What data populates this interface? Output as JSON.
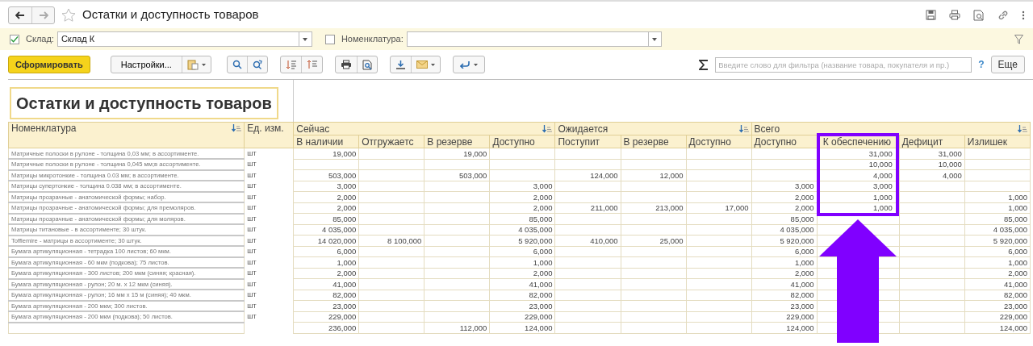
{
  "window": {
    "title": "Остатки и доступность товаров"
  },
  "filters": [
    {
      "label": "Склад:",
      "checked": true,
      "value": "Склад К"
    },
    {
      "label": "Номенклатура:",
      "checked": false
    }
  ],
  "toolbar": {
    "generate_button": "Сформировать",
    "settings_button": "Настройки...",
    "search": {
      "placeholder": "Введите слово для фильтра (название товара, покупателя и пр.)"
    },
    "help": "?",
    "more_button": "Еще"
  },
  "report": {
    "title": "Остатки и доступность товаров",
    "name_column": "Номенклатура",
    "unit_column": "Ед. изм.",
    "groups": [
      {
        "label": "Сейчас",
        "columns": [
          {
            "label": "В наличии",
            "highlighted": false
          },
          {
            "label": "Отгружаетс",
            "highlighted": false
          },
          {
            "label": "В резерве",
            "highlighted": false
          },
          {
            "label": "Доступно",
            "highlighted": false
          }
        ]
      },
      {
        "label": "Ожидается",
        "columns": [
          {
            "label": "Поступит",
            "highlighted": false
          },
          {
            "label": "В резерве",
            "highlighted": false
          },
          {
            "label": "Доступно",
            "highlighted": false
          }
        ]
      },
      {
        "label": "Всего",
        "columns": [
          {
            "label": "Доступно",
            "highlighted": false
          },
          {
            "label": "К обеспечению",
            "highlighted": true
          },
          {
            "label": "Дефицит",
            "highlighted": false
          },
          {
            "label": "Излишек",
            "highlighted": false
          }
        ]
      }
    ],
    "rows": [
      {
        "name": "Матричные полоски в рулоне - толщина 0,03 мм; в ассортименте.",
        "unit": "шт",
        "highlighted": true,
        "cells": [
          "19,000",
          null,
          "19,000",
          null,
          null,
          null,
          null,
          null,
          "31,000",
          "31,000",
          null
        ]
      },
      {
        "name": "Матричные полоски в рулоне - толщина 0,045 мм;в ассортименте.",
        "unit": "шт",
        "highlighted": true,
        "cells": [
          null,
          null,
          null,
          null,
          null,
          null,
          null,
          null,
          "10,000",
          "10,000",
          null
        ]
      },
      {
        "name": "Матрицы микротонкие - толщина 0.03 мм; в ассортименте.",
        "unit": "шт",
        "highlighted": true,
        "cells": [
          "503,000",
          null,
          "503,000",
          null,
          "124,000",
          "12,000",
          null,
          null,
          "4,000",
          "4,000",
          null
        ]
      },
      {
        "name": "Матрицы супертонкие - толщина 0.038 мм; в ассортименте.",
        "unit": "шт",
        "highlighted": true,
        "cells": [
          "3,000",
          null,
          null,
          "3,000",
          null,
          null,
          null,
          "3,000",
          "3,000",
          null,
          null
        ]
      },
      {
        "name": "Матрицы прозрачные - анатомической формы; набор.",
        "unit": "шт",
        "highlighted": true,
        "cells": [
          "2,000",
          null,
          null,
          "2,000",
          null,
          null,
          null,
          "2,000",
          "1,000",
          null,
          "1,000"
        ]
      },
      {
        "name": "Матрицы прозрачные - анатомической формы; для премоляров.",
        "unit": "шт",
        "highlighted": true,
        "cells": [
          "2,000",
          null,
          null,
          "2,000",
          "211,000",
          "213,000",
          "17,000",
          "2,000",
          "1,000",
          null,
          "1,000"
        ]
      },
      {
        "name": "Матрицы прозрачные -  анатомической формы; для моляров.",
        "unit": "шт",
        "highlighted": false,
        "cells": [
          "85,000",
          null,
          null,
          "85,000",
          null,
          null,
          null,
          "85,000",
          null,
          null,
          "85,000"
        ]
      },
      {
        "name": "Матрицы титановые - в ассортименте; 30 штук.",
        "unit": "шт",
        "highlighted": false,
        "cells": [
          "4 035,000",
          null,
          null,
          "4 035,000",
          null,
          null,
          null,
          "4 035,000",
          null,
          null,
          "4 035,000"
        ]
      },
      {
        "name": "Tofflemire - матрицы в ассортименте; 30 штук.",
        "unit": "шт",
        "highlighted": false,
        "cells": [
          "14 020,000",
          "8 100,000",
          null,
          "5 920,000",
          "410,000",
          "25,000",
          null,
          "5 920,000",
          null,
          null,
          "5 920,000"
        ]
      },
      {
        "name": "Бумага артикуляционная - тетрадка 100 листов; 60 мкм.",
        "unit": "шт",
        "highlighted": false,
        "cells": [
          "6,000",
          null,
          null,
          "6,000",
          null,
          null,
          null,
          "6,000",
          null,
          null,
          "6,000"
        ]
      },
      {
        "name": "Бумага артикуляционная - 60 мкм (подкова); 75 листов.",
        "unit": "шт",
        "highlighted": false,
        "cells": [
          "1,000",
          null,
          null,
          "1,000",
          null,
          null,
          null,
          "1,000",
          null,
          null,
          "1,000"
        ]
      },
      {
        "name": "Бумага артикуляционная - 300 листов; 200 мкм (синяя; красная).",
        "unit": "шт",
        "highlighted": false,
        "cells": [
          "2,000",
          null,
          null,
          "2,000",
          null,
          null,
          null,
          "2,000",
          null,
          null,
          "2,000"
        ]
      },
      {
        "name": "Бумага артикуляционная - рулон; 20 м. х 12 мкм (синяя).",
        "unit": "шт",
        "highlighted": false,
        "cells": [
          "41,000",
          null,
          null,
          "41,000",
          null,
          null,
          null,
          "41,000",
          null,
          null,
          "41,000"
        ]
      },
      {
        "name": "Бумага артикуляционная - рулон; 16 мм х 15 м (синяя); 40 мкм.",
        "unit": "шт",
        "highlighted": false,
        "cells": [
          "82,000",
          null,
          null,
          "82,000",
          null,
          null,
          null,
          "82,000",
          null,
          null,
          "82,000"
        ]
      },
      {
        "name": "Бумага артикуляционная - 200 мкм; 300 листов.",
        "unit": "шт",
        "highlighted": false,
        "cells": [
          "23,000",
          null,
          null,
          "23,000",
          null,
          null,
          null,
          "23,000",
          null,
          null,
          "23,000"
        ]
      },
      {
        "name": "Бумага артикуляционная - 200 мкм (подкова); 50 листов.",
        "unit": "шт",
        "highlighted": false,
        "cells": [
          "229,000",
          null,
          null,
          "229,000",
          null,
          null,
          null,
          "229,000",
          null,
          null,
          "229,000"
        ]
      },
      {
        "highlighted": false,
        "cells": [
          "236,000",
          null,
          "112,000",
          "124,000",
          null,
          null,
          null,
          "124,000",
          null,
          null,
          "124,000"
        ]
      }
    ]
  }
}
